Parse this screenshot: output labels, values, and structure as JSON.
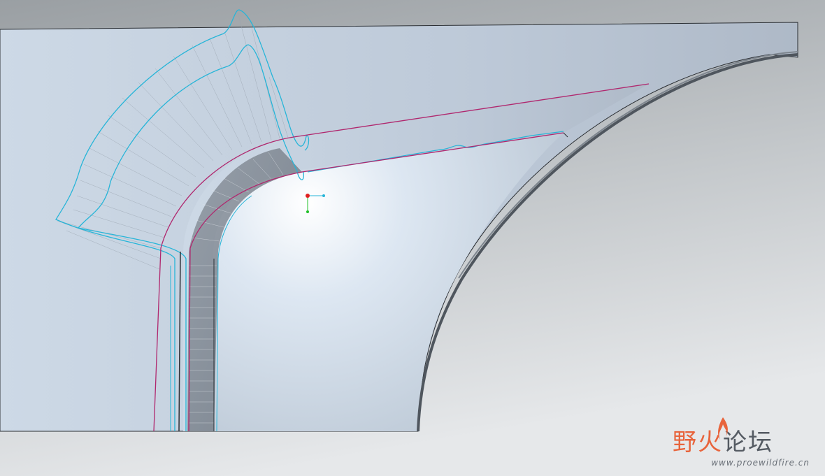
{
  "watermark": {
    "brand_part1": "野火",
    "brand_part2": "论坛",
    "url": "www.proewildfire.cn"
  },
  "colors": {
    "background_top": "#9ea3a6",
    "background_bottom": "#e3e6e8",
    "part_surface": "#c2cfdd",
    "highlight": "#ffffff",
    "edge_dark": "#555b63",
    "curvature_comb": "#27b5d8",
    "selected_edge": "#b0276e",
    "coordinate_red": "#e02020",
    "coordinate_green": "#22c02a",
    "coordinate_cyan": "#27b5d8",
    "watermark_orange": "#e8643c"
  },
  "icons": {
    "coordinate_system": "csys-icon",
    "watermark_logo": "flame-icon"
  }
}
